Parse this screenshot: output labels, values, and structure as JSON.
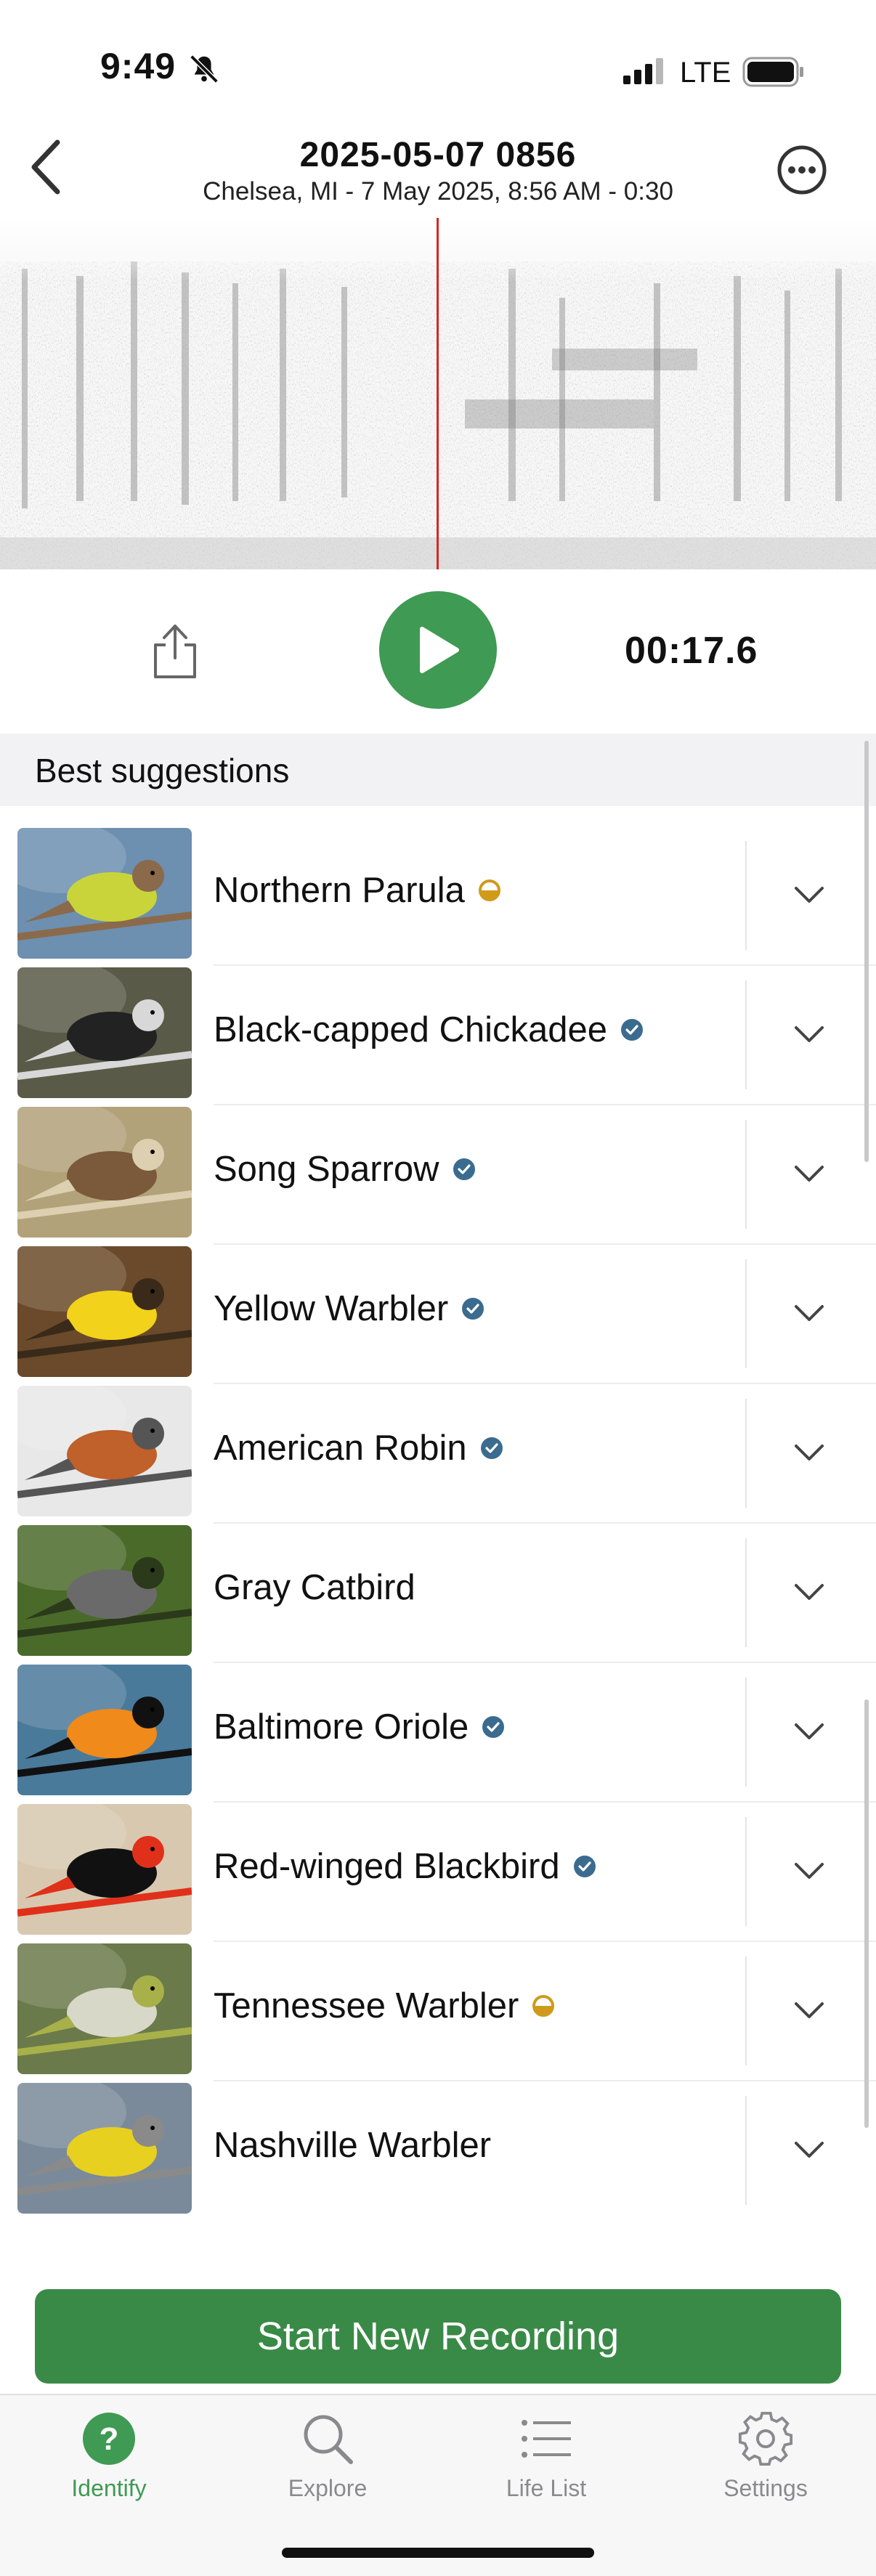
{
  "status_bar": {
    "time": "9:49",
    "network": "LTE"
  },
  "header": {
    "title": "2025-05-07 0856",
    "subtitle": "Chelsea, MI - 7 May 2025, 8:56 AM - 0:30"
  },
  "player": {
    "timecode": "00:17.6"
  },
  "section": {
    "label": "Best suggestions"
  },
  "suggestions": [
    {
      "name": "Northern Parula",
      "badge": "half-circle-icon",
      "thumb_colors": [
        "#6d8fb0",
        "#c9d43a",
        "#8a6a4a"
      ]
    },
    {
      "name": "Black-capped Chickadee",
      "badge": "verified-check-icon",
      "thumb_colors": [
        "#5a5a48",
        "#222222",
        "#d8d8d8"
      ]
    },
    {
      "name": "Song Sparrow",
      "badge": "verified-check-icon",
      "thumb_colors": [
        "#b2a27a",
        "#7a5a3a",
        "#ddd0b0"
      ]
    },
    {
      "name": "Yellow Warbler",
      "badge": "verified-check-icon",
      "thumb_colors": [
        "#6a4a2a",
        "#f2d21a",
        "#3a2a1a"
      ]
    },
    {
      "name": "American Robin",
      "badge": "verified-check-icon",
      "thumb_colors": [
        "#e8e8e8",
        "#c0602a",
        "#555555"
      ]
    },
    {
      "name": "Gray Catbird",
      "badge": "",
      "thumb_colors": [
        "#4a6a2a",
        "#6a6a6a",
        "#2a3a1a"
      ]
    },
    {
      "name": "Baltimore Oriole",
      "badge": "verified-check-icon",
      "thumb_colors": [
        "#4a7a9a",
        "#f08a1a",
        "#111111"
      ]
    },
    {
      "name": "Red-winged Blackbird",
      "badge": "verified-check-icon",
      "thumb_colors": [
        "#d8c8b0",
        "#111111",
        "#e0301a"
      ]
    },
    {
      "name": "Tennessee Warbler",
      "badge": "half-circle-icon",
      "thumb_colors": [
        "#6a7a4a",
        "#d8d8c8",
        "#a8b04a"
      ]
    },
    {
      "name": "Nashville Warbler",
      "badge": "",
      "thumb_colors": [
        "#7a8a9a",
        "#e8d020",
        "#8a8a8a"
      ]
    }
  ],
  "actions": {
    "start_label": "Start New Recording"
  },
  "tabs": [
    {
      "label": "Identify",
      "icon": "question-circle-icon",
      "active": true
    },
    {
      "label": "Explore",
      "icon": "search-icon",
      "active": false
    },
    {
      "label": "Life List",
      "icon": "list-icon",
      "active": false
    },
    {
      "label": "Settings",
      "icon": "gear-icon",
      "active": false
    }
  ],
  "colors": {
    "accent": "#3f9a53",
    "start_button": "#3a8a47",
    "verified_badge": "#3b6b8f",
    "half_badge": "#d09a1a",
    "playhead": "#d9252a"
  }
}
